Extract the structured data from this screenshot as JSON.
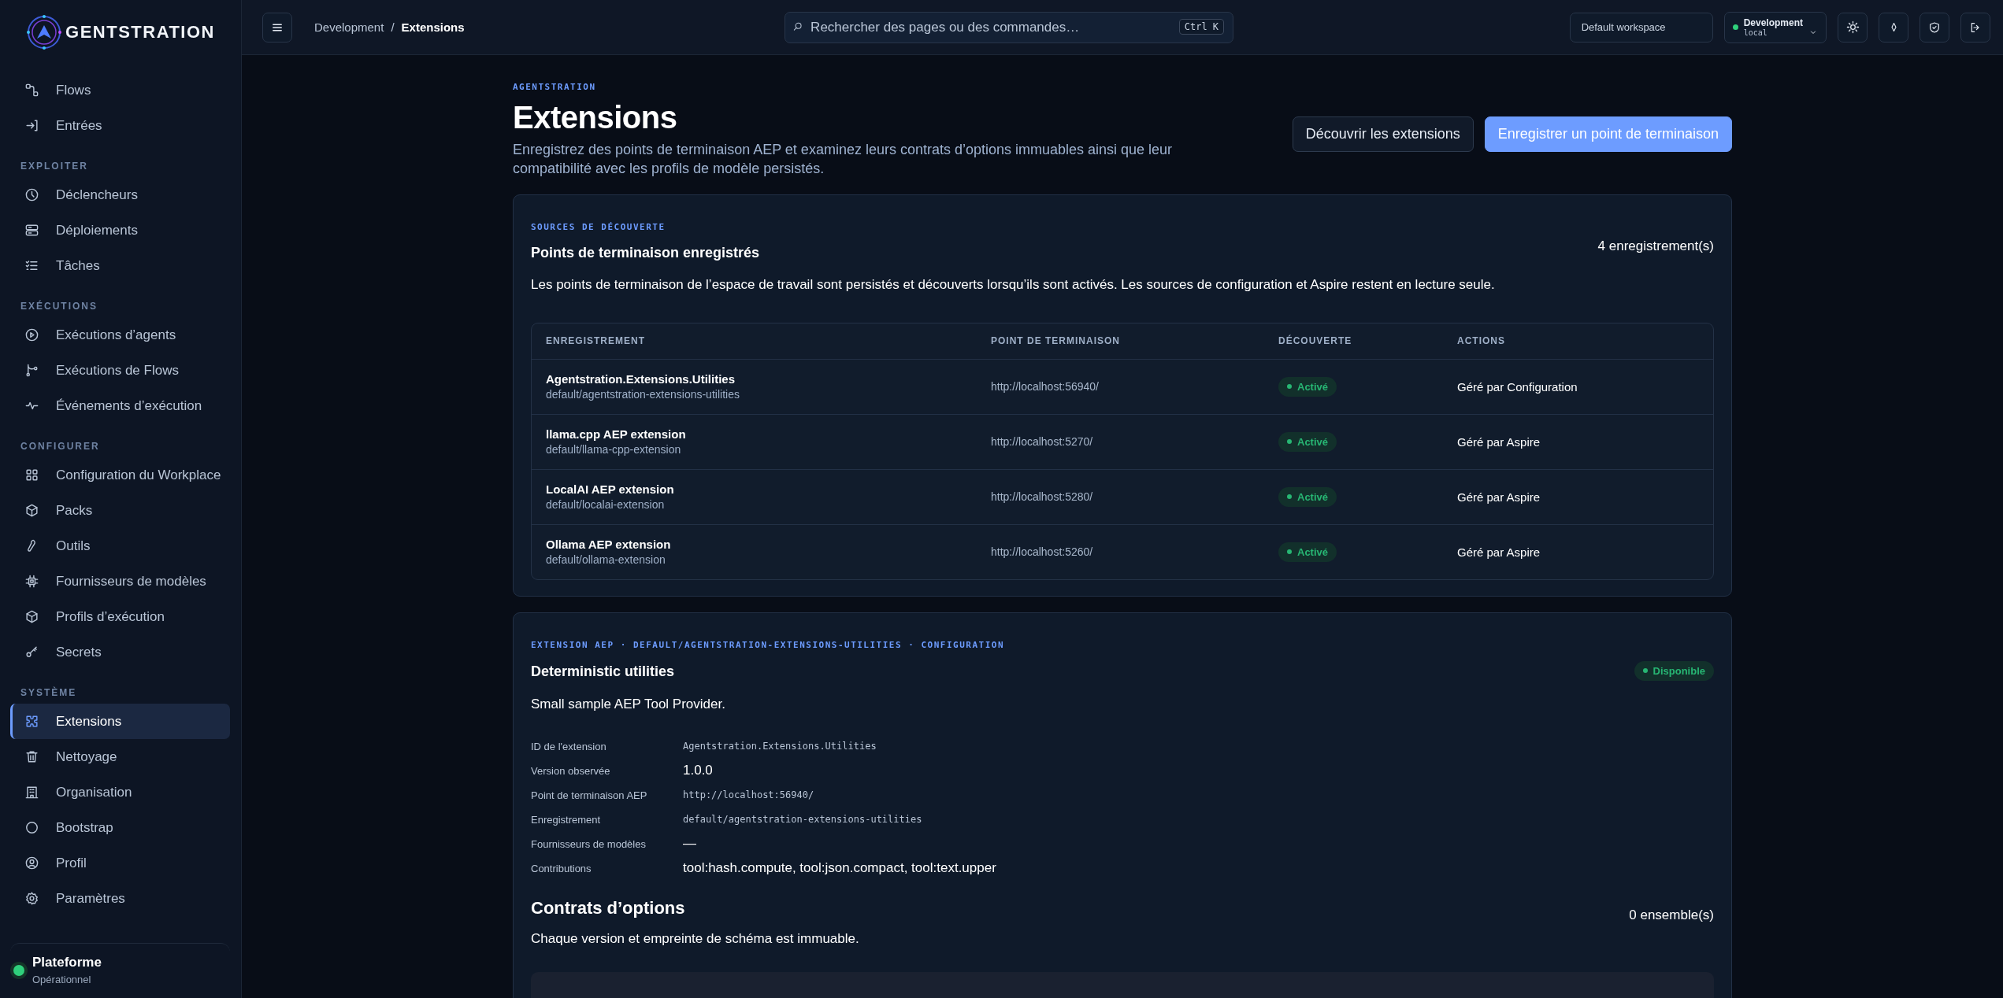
{
  "sidebar": {
    "brand": "GENTSTRATION",
    "sections": [
      {
        "items": [
          {
            "label": "Flows",
            "selected": false
          },
          {
            "label": "Entrées",
            "selected": false
          }
        ]
      },
      {
        "heading": "EXPLOITER",
        "items": [
          {
            "label": "Déclencheurs",
            "selected": false
          },
          {
            "label": "Déploiements",
            "selected": false
          },
          {
            "label": "Tâches",
            "selected": false
          }
        ]
      },
      {
        "heading": "EXÉCUTIONS",
        "items": [
          {
            "label": "Exécutions d’agents",
            "selected": false
          },
          {
            "label": "Exécutions de Flows",
            "selected": false
          },
          {
            "label": "Événements d’exécution",
            "selected": false
          }
        ]
      },
      {
        "heading": "CONFIGURER",
        "items": [
          {
            "label": "Configuration du Workplace",
            "selected": false
          },
          {
            "label": "Packs",
            "selected": false
          },
          {
            "label": "Outils",
            "selected": false
          },
          {
            "label": "Fournisseurs de modèles",
            "selected": false
          },
          {
            "label": "Profils d’exécution",
            "selected": false
          },
          {
            "label": "Secrets",
            "selected": false
          }
        ]
      },
      {
        "heading": "SYSTÈME",
        "items": [
          {
            "label": "Extensions",
            "selected": true
          },
          {
            "label": "Nettoyage",
            "selected": false
          },
          {
            "label": "Organisation",
            "selected": false
          },
          {
            "label": "Bootstrap",
            "selected": false
          },
          {
            "label": "Profil",
            "selected": false
          },
          {
            "label": "Paramètres",
            "selected": false
          }
        ]
      }
    ],
    "status": {
      "title": "Plateforme",
      "subtitle": "Opérationnel"
    }
  },
  "topbar": {
    "breadcrumb": [
      {
        "label": "Development",
        "current": false
      },
      {
        "label": "Extensions",
        "current": true
      }
    ],
    "separator": "/",
    "search": {
      "placeholder": "Rechercher des pages ou des commandes…",
      "shortcut": "Ctrl K"
    },
    "workspace": "Default workspace",
    "environment": {
      "name": "Development",
      "detail": "local"
    }
  },
  "header": {
    "eyebrow": "AGENTSTRATION",
    "title": "Extensions",
    "description": "Enregistrez des points de terminaison AEP et examinez leurs contrats d’options immuables ainsi que leur compatibilité avec les profils de modèle persistés.",
    "buttons": [
      {
        "label": "Découvrir les extensions",
        "kind": "secondary"
      },
      {
        "label": "Enregistrer un point de terminaison",
        "kind": "primary"
      }
    ]
  },
  "endpoints": {
    "eyebrow": "SOURCES DE DÉCOUVERTE",
    "title": "Points de terminaison enregistrés",
    "count": "4 enregistrement(s)",
    "description": "Les points de terminaison de l’espace de travail sont persistés et découverts lorsqu’ils sont activés. Les sources de configuration et Aspire restent en lecture seule.",
    "table": {
      "columns": [
        "ENREGISTREMENT",
        "POINT DE TERMINAISON",
        "DÉCOUVERTE",
        "ACTIONS"
      ],
      "rows": [
        {
          "name": "Agentstration.Extensions.Utilities",
          "path": "default/agentstration-extensions-utilities",
          "endpoint": "http://localhost:56940/",
          "status": "Activé",
          "action": "Géré par Configuration"
        },
        {
          "name": "llama.cpp AEP extension",
          "path": "default/llama-cpp-extension",
          "endpoint": "http://localhost:5270/",
          "status": "Activé",
          "action": "Géré par Aspire"
        },
        {
          "name": "LocalAI AEP extension",
          "path": "default/localai-extension",
          "endpoint": "http://localhost:5280/",
          "status": "Activé",
          "action": "Géré par Aspire"
        },
        {
          "name": "Ollama AEP extension",
          "path": "default/ollama-extension",
          "endpoint": "http://localhost:5260/",
          "status": "Activé",
          "action": "Géré par Aspire"
        }
      ]
    }
  },
  "extension": {
    "eyebrow": "EXTENSION AEP · DEFAULT/AGENTSTRATION-EXTENSIONS-UTILITIES · CONFIGURATION",
    "title": "Deterministic utilities",
    "status": "Disponible",
    "description": "Small sample AEP Tool Provider.",
    "fields": [
      {
        "label": "ID de l'extension",
        "value": "Agentstration.Extensions.Utilities",
        "kind": "mono"
      },
      {
        "label": "Version observée",
        "value": "1.0.0",
        "kind": "text"
      },
      {
        "label": "Point de terminaison AEP",
        "value": "http://localhost:56940/",
        "kind": "mono"
      },
      {
        "label": "Enregistrement",
        "value": "default/agentstration-extensions-utilities",
        "kind": "mono"
      },
      {
        "label": "Fournisseurs de modèles",
        "value": "—",
        "kind": "text"
      },
      {
        "label": "Contributions",
        "value": "tool:hash.compute, tool:json.compact, tool:text.upper",
        "kind": "text"
      }
    ],
    "contracts": {
      "title": "Contrats d’options",
      "count": "0 ensemble(s)",
      "description": "Chaque version et empreinte de schéma est immuable."
    }
  }
}
